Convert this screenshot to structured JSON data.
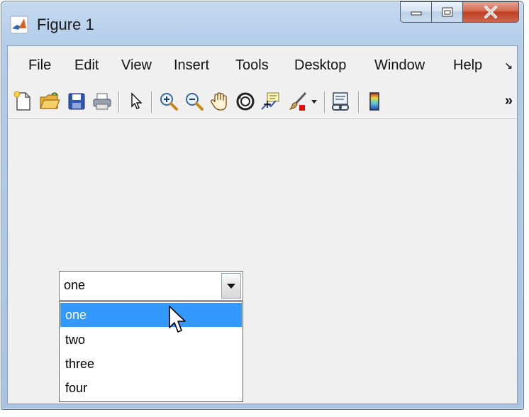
{
  "window": {
    "title": "Figure 1",
    "icon": "matlab-icon",
    "controls": [
      "minimize-icon",
      "maximize-icon",
      "close-icon"
    ]
  },
  "menu": {
    "items": [
      {
        "label": "File"
      },
      {
        "label": "Edit"
      },
      {
        "label": "View"
      },
      {
        "label": "Insert"
      },
      {
        "label": "Tools"
      },
      {
        "label": "Desktop"
      },
      {
        "label": "Window"
      },
      {
        "label": "Help"
      }
    ],
    "dock_glyph": "↘"
  },
  "toolbar": {
    "buttons": [
      "new-figure-icon",
      "open-file-icon",
      "save-icon",
      "print-icon",
      "edit-plot-icon",
      "zoom-in-icon",
      "zoom-out-icon",
      "pan-icon",
      "rotate-3d-icon",
      "data-cursor-icon",
      "brush-icon",
      "brush-dropdown-icon",
      "link-plot-icon",
      "colorbar-icon"
    ],
    "overflow_glyph": "»"
  },
  "popup": {
    "value": "one",
    "options": [
      {
        "label": "one",
        "selected": true
      },
      {
        "label": "two",
        "selected": false
      },
      {
        "label": "three",
        "selected": false
      },
      {
        "label": "four",
        "selected": false
      }
    ]
  },
  "colors": {
    "selection": "#3399ff",
    "figure_background": "#f0f0f0",
    "title_bar": "#b9d1ea"
  }
}
